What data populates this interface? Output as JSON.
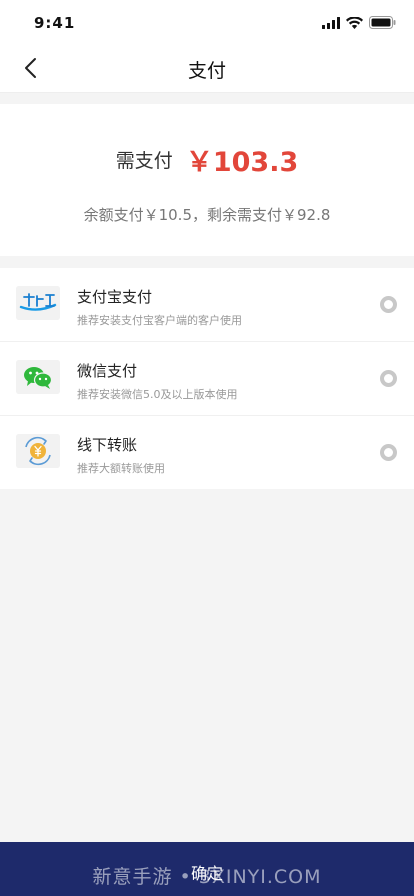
{
  "status_bar": {
    "time": "9:41"
  },
  "nav": {
    "title": "支付",
    "back_icon": "chevron-left-icon"
  },
  "amount": {
    "label": "需支付",
    "value": "￥103.3",
    "detail": "余额支付￥10.5，剩余需支付￥92.8",
    "value_color": "#e2463a"
  },
  "methods": [
    {
      "name": "支付宝支付",
      "desc": "推荐安装支付宝客户端的客户使用",
      "icon": "alipay-icon",
      "selected": false
    },
    {
      "name": "微信支付",
      "desc": "推荐安装微信5.0及以上版本使用",
      "icon": "wechat-icon",
      "selected": false
    },
    {
      "name": "线下转账",
      "desc": "推荐大额转账使用",
      "icon": "transfer-icon",
      "selected": false
    }
  ],
  "confirm": {
    "label": "确定",
    "bar_color": "#1e2a6b"
  },
  "watermark": {
    "text": "新意手游 • 3XINYI.COM"
  }
}
